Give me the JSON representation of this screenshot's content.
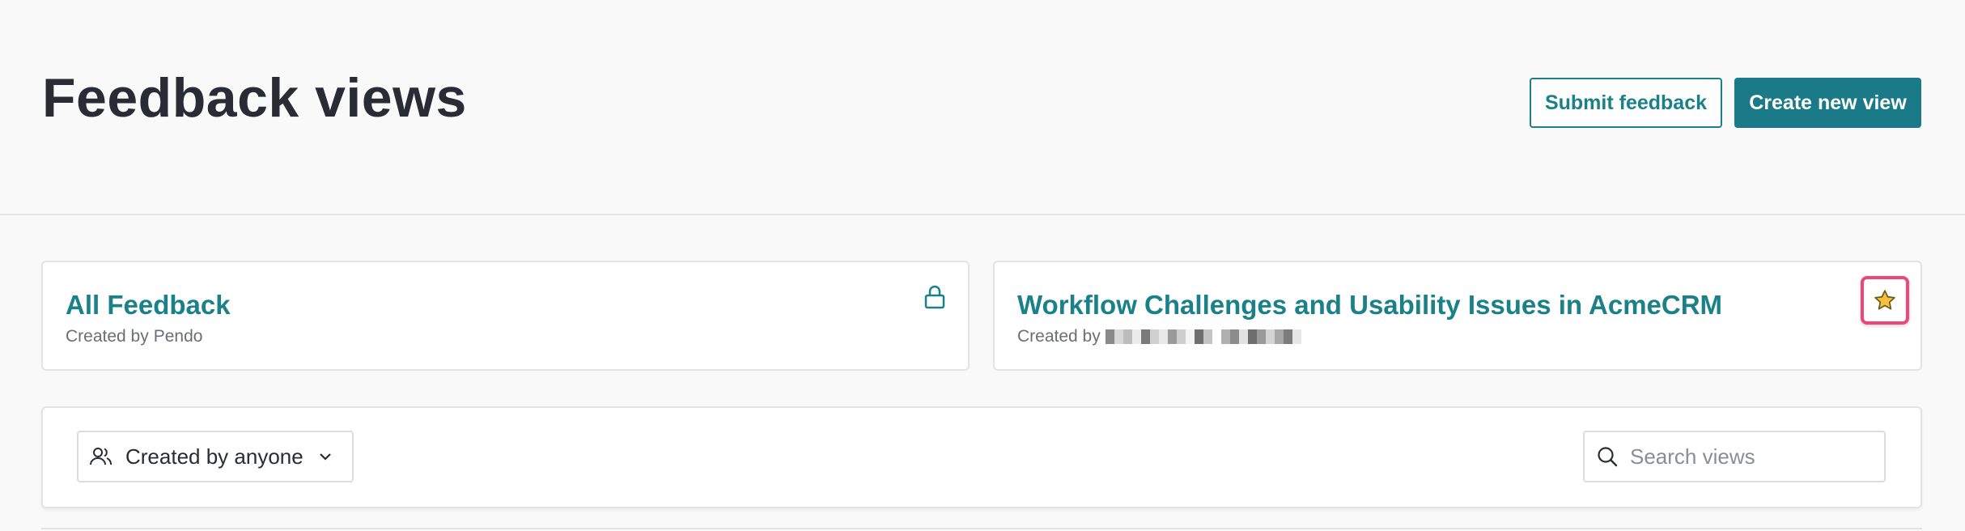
{
  "header": {
    "title": "Feedback views",
    "submit_label": "Submit feedback",
    "create_label": "Create new view"
  },
  "cards": [
    {
      "title": "All Feedback",
      "created_prefix": "Created by",
      "creator": "Pendo",
      "icon": "lock-icon"
    },
    {
      "title": "Workflow Challenges and Usability Issues in AcmeCRM",
      "created_prefix": "Created by",
      "creator_redacted": true,
      "icon": "star-icon"
    }
  ],
  "filters": {
    "creator_select": "Created by anyone",
    "search_placeholder": "Search views"
  },
  "colors": {
    "accent": "#1a8189",
    "primary_button": "#1a7a88",
    "highlight_border": "#f0457a",
    "star_fill": "#f5c13d"
  }
}
